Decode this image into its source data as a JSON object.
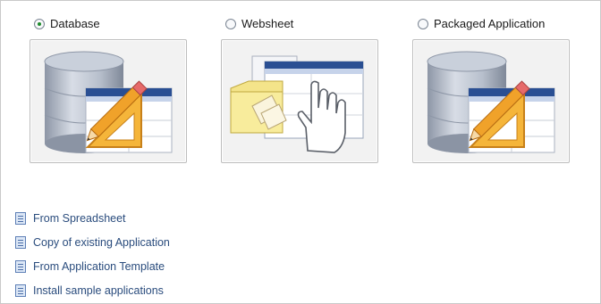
{
  "options": [
    {
      "label": "Database",
      "checked": true,
      "icon": "database-pencil-icon"
    },
    {
      "label": "Websheet",
      "checked": false,
      "icon": "websheet-hand-icon"
    },
    {
      "label": "Packaged Application",
      "checked": false,
      "icon": "packaged-database-pencil-icon"
    }
  ],
  "links": [
    {
      "label": "From Spreadsheet",
      "icon": "document-icon"
    },
    {
      "label": "Copy of existing Application",
      "icon": "document-icon"
    },
    {
      "label": "From Application Template",
      "icon": "document-icon"
    },
    {
      "label": "Install sample applications",
      "icon": "document-icon"
    }
  ],
  "colors": {
    "link": "#2a4c7d",
    "selected_radio": "#1d8a2b",
    "window_blue": "#2a4f93",
    "pencil_orange": "#f0a22a"
  }
}
